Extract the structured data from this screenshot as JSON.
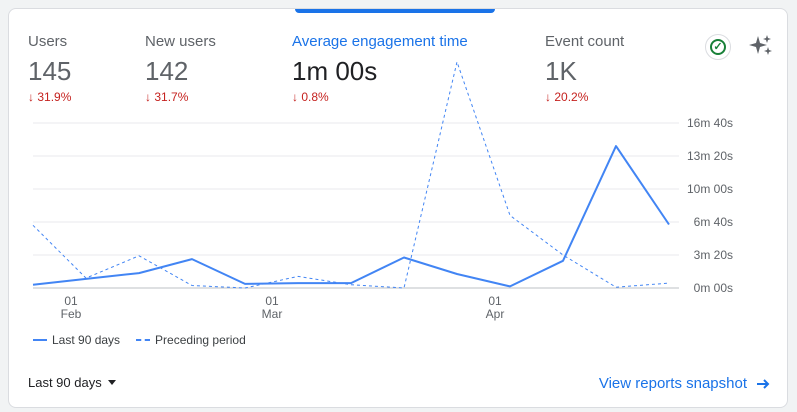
{
  "metrics": [
    {
      "label": "Users",
      "value": "145",
      "delta": "31.9%"
    },
    {
      "label": "New users",
      "value": "142",
      "delta": "31.7%"
    },
    {
      "label": "Average engagement time",
      "value": "1m 00s",
      "delta": "0.8%"
    },
    {
      "label": "Event count",
      "value": "1K",
      "delta": "20.2%"
    }
  ],
  "icons": {
    "status": "check-circle-icon",
    "insights": "sparkle-icon",
    "delta": "arrow-down-icon",
    "link": "arrow-right-icon"
  },
  "colors": {
    "accent": "#1a73e8",
    "negative": "#c5221f",
    "positive": "#188038"
  },
  "chart_data": {
    "type": "line",
    "x_ticks": [
      {
        "day": "01",
        "month": "Feb"
      },
      {
        "day": "01",
        "month": "Mar"
      },
      {
        "day": "01",
        "month": "Apr"
      }
    ],
    "y_ticks": [
      "0m 00s",
      "3m 20s",
      "6m 40s",
      "10m 00s",
      "13m 20s",
      "16m 40s"
    ],
    "ylim": [
      0,
      1000
    ],
    "series": [
      {
        "name": "Last 90 days",
        "style": "solid",
        "values": [
          20,
          55,
          90,
          175,
          25,
          30,
          30,
          185,
          85,
          10,
          165,
          860,
          385
        ]
      },
      {
        "name": "Preceding period",
        "style": "dashed",
        "values": [
          380,
          60,
          195,
          15,
          0,
          70,
          20,
          0,
          1370,
          440,
          200,
          5,
          30
        ]
      }
    ]
  },
  "footer": {
    "range_label": "Last 90 days",
    "link_label": "View reports snapshot"
  }
}
